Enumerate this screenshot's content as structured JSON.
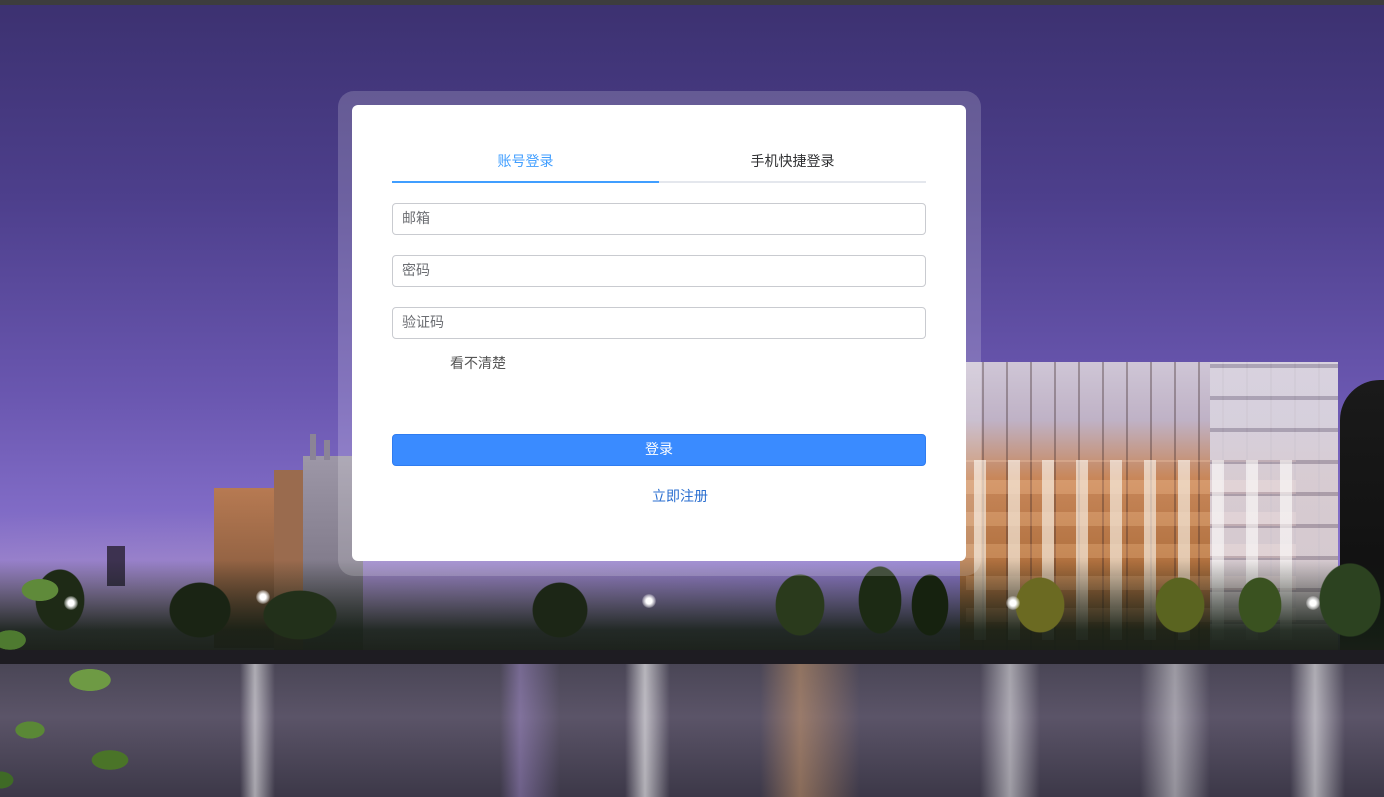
{
  "login": {
    "tabs": [
      {
        "label": "账号登录",
        "active": true
      },
      {
        "label": "手机快捷登录",
        "active": false
      }
    ],
    "email_placeholder": "邮箱",
    "password_placeholder": "密码",
    "captcha_placeholder": "验证码",
    "captcha_refresh_label": "看不清楚",
    "submit_label": "登录",
    "register_label": "立即注册"
  },
  "colors": {
    "accent": "#409eff",
    "button": "#3a8bff",
    "link": "#2b6fd0"
  }
}
